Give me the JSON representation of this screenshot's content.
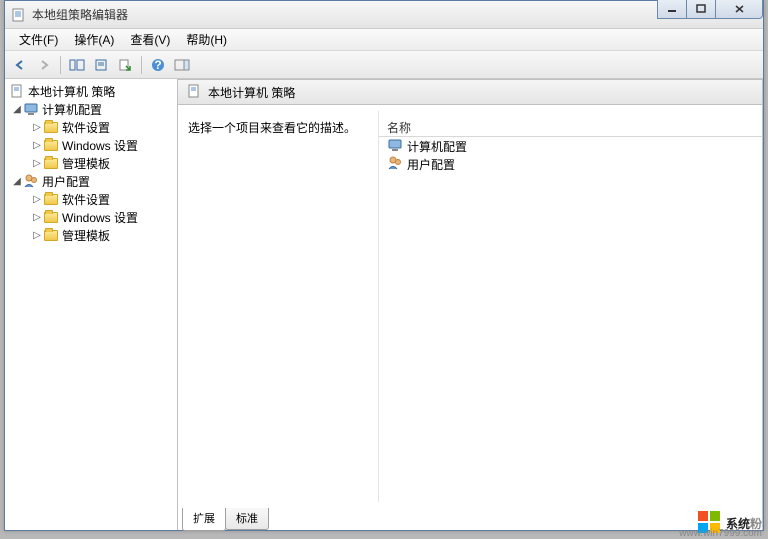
{
  "window": {
    "title": "本地组策略编辑器"
  },
  "menubar": [
    {
      "label": "文件(F)"
    },
    {
      "label": "操作(A)"
    },
    {
      "label": "查看(V)"
    },
    {
      "label": "帮助(H)"
    }
  ],
  "tree": {
    "root": "本地计算机 策略",
    "nodes": [
      {
        "label": "计算机配置",
        "children": [
          "软件设置",
          "Windows 设置",
          "管理模板"
        ]
      },
      {
        "label": "用户配置",
        "children": [
          "软件设置",
          "Windows 设置",
          "管理模板"
        ]
      }
    ]
  },
  "main": {
    "header": "本地计算机 策略",
    "description": "选择一个项目来查看它的描述。",
    "column_name": "名称",
    "items": [
      {
        "label": "计算机配置",
        "icon": "computer"
      },
      {
        "label": "用户配置",
        "icon": "user"
      }
    ],
    "tabs": [
      "扩展",
      "标准"
    ],
    "active_tab": 0
  },
  "watermark": {
    "text_main": "系统",
    "text_sub": "粉",
    "url": "www.win7999.com"
  }
}
